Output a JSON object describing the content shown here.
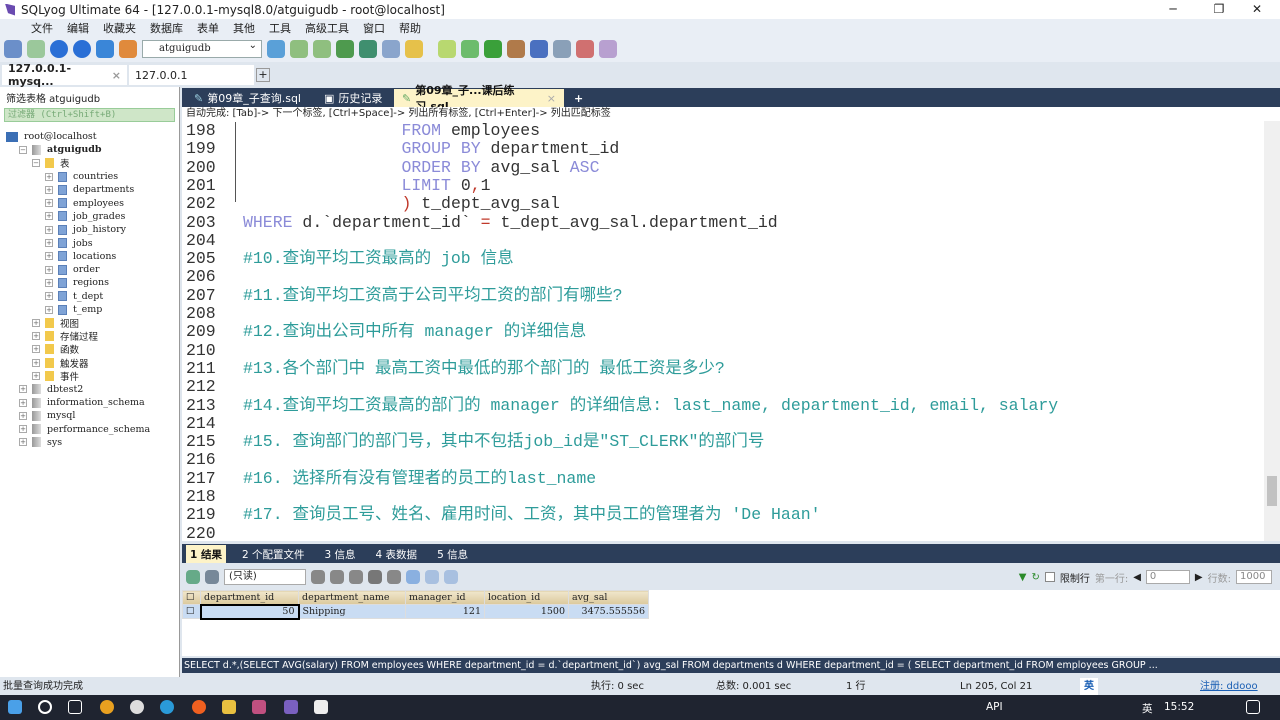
{
  "window": {
    "title": "SQLyog Ultimate 64 - [127.0.0.1-mysql8.0/atguigudb - root@localhost]",
    "minimize": "─",
    "maximize": "❐",
    "close": "✕"
  },
  "menu": [
    "文件",
    "编辑",
    "收藏夹",
    "数据库",
    "表单",
    "其他",
    "工具",
    "高级工具",
    "窗口",
    "帮助"
  ],
  "toolbar": {
    "database": "atguigudb"
  },
  "connection_tabs": [
    {
      "label": "127.0.0.1-mysq...",
      "close": "×"
    },
    {
      "label": "127.0.0.1"
    }
  ],
  "sidebar": {
    "filter_label": "筛选表格 atguigudb",
    "filter_placeholder": "过滤器 (Ctrl+Shift+B)",
    "tree": [
      {
        "label": "root@localhost",
        "level": 0,
        "icon": "server",
        "pm": ""
      },
      {
        "label": "atguigudb",
        "level": 1,
        "icon": "db",
        "pm": "⊟",
        "bold": true
      },
      {
        "label": "表",
        "level": 2,
        "icon": "folder",
        "pm": "⊟"
      },
      {
        "label": "countries",
        "level": 3,
        "icon": "table",
        "pm": "+"
      },
      {
        "label": "departments",
        "level": 3,
        "icon": "table",
        "pm": "+"
      },
      {
        "label": "employees",
        "level": 3,
        "icon": "table",
        "pm": "+"
      },
      {
        "label": "job_grades",
        "level": 3,
        "icon": "table",
        "pm": "+"
      },
      {
        "label": "job_history",
        "level": 3,
        "icon": "table",
        "pm": "+"
      },
      {
        "label": "jobs",
        "level": 3,
        "icon": "table",
        "pm": "+"
      },
      {
        "label": "locations",
        "level": 3,
        "icon": "table",
        "pm": "+"
      },
      {
        "label": "order",
        "level": 3,
        "icon": "table",
        "pm": "+"
      },
      {
        "label": "regions",
        "level": 3,
        "icon": "table",
        "pm": "+"
      },
      {
        "label": "t_dept",
        "level": 3,
        "icon": "table",
        "pm": "+"
      },
      {
        "label": "t_emp",
        "level": 3,
        "icon": "table",
        "pm": "+"
      },
      {
        "label": "视图",
        "level": 2,
        "icon": "folder",
        "pm": "+"
      },
      {
        "label": "存储过程",
        "level": 2,
        "icon": "folder",
        "pm": "+"
      },
      {
        "label": "函数",
        "level": 2,
        "icon": "folder",
        "pm": "+"
      },
      {
        "label": "触发器",
        "level": 2,
        "icon": "folder",
        "pm": "+"
      },
      {
        "label": "事件",
        "level": 2,
        "icon": "folder",
        "pm": "+"
      },
      {
        "label": "dbtest2",
        "level": 1,
        "icon": "db",
        "pm": "+"
      },
      {
        "label": "information_schema",
        "level": 1,
        "icon": "db",
        "pm": "+"
      },
      {
        "label": "mysql",
        "level": 1,
        "icon": "db",
        "pm": "+"
      },
      {
        "label": "performance_schema",
        "level": 1,
        "icon": "db",
        "pm": "+"
      },
      {
        "label": "sys",
        "level": 1,
        "icon": "db",
        "pm": "+"
      }
    ]
  },
  "editor_tabs": [
    {
      "label": "第09章_子查询.sql"
    },
    {
      "label": "历史记录"
    },
    {
      "label": "第09章_子...课后练习.sql",
      "close": "×",
      "active": true
    }
  ],
  "editor_tabs_add": "+",
  "autocomplete_hint": "自动完成: [Tab]-> 下一个标签, [Ctrl+Space]-> 列出所有标签, [Ctrl+Enter]-> 列出匹配标签",
  "editor": {
    "lines": [
      {
        "n": "198",
        "tokens": [
          [
            "p",
            "                "
          ],
          [
            "k",
            "FROM"
          ],
          [
            "p",
            " employees"
          ]
        ]
      },
      {
        "n": "199",
        "tokens": [
          [
            "p",
            "                "
          ],
          [
            "k",
            "GROUP BY"
          ],
          [
            "p",
            " department_id"
          ]
        ]
      },
      {
        "n": "200",
        "tokens": [
          [
            "p",
            "                "
          ],
          [
            "k",
            "ORDER BY"
          ],
          [
            "p",
            " avg_sal "
          ],
          [
            "k",
            "ASC"
          ]
        ]
      },
      {
        "n": "201",
        "tokens": [
          [
            "p",
            "                "
          ],
          [
            "k",
            "LIMIT"
          ],
          [
            "p",
            " 0"
          ],
          [
            "r",
            ","
          ],
          [
            "p",
            "1"
          ]
        ]
      },
      {
        "n": "202",
        "tokens": [
          [
            "p",
            "                "
          ],
          [
            "r",
            ")"
          ],
          [
            "p",
            " t_dept_avg_sal"
          ]
        ]
      },
      {
        "n": "203",
        "tokens": [
          [
            "k",
            "WHERE"
          ],
          [
            "p",
            " d.`department_id` "
          ],
          [
            "r",
            "="
          ],
          [
            "p",
            " t_dept_avg_sal.department_id"
          ]
        ]
      },
      {
        "n": "204",
        "tokens": []
      },
      {
        "n": "205",
        "tokens": [
          [
            "c",
            "#10.查询平均工资最高的 job 信息"
          ]
        ]
      },
      {
        "n": "206",
        "tokens": []
      },
      {
        "n": "207",
        "tokens": [
          [
            "c",
            "#11.查询平均工资高于公司平均工资的部门有哪些?"
          ]
        ]
      },
      {
        "n": "208",
        "tokens": []
      },
      {
        "n": "209",
        "tokens": [
          [
            "c",
            "#12.查询出公司中所有 manager 的详细信息"
          ]
        ]
      },
      {
        "n": "210",
        "tokens": []
      },
      {
        "n": "211",
        "tokens": [
          [
            "c",
            "#13.各个部门中 最高工资中最低的那个部门的 最低工资是多少?"
          ]
        ]
      },
      {
        "n": "212",
        "tokens": []
      },
      {
        "n": "213",
        "tokens": [
          [
            "c",
            "#14.查询平均工资最高的部门的 manager 的详细信息: last_name, department_id, email, salary"
          ]
        ]
      },
      {
        "n": "214",
        "tokens": []
      },
      {
        "n": "215",
        "tokens": [
          [
            "c",
            "#15. 查询部门的部门号，其中不包括job_id是\"ST_CLERK\"的部门号"
          ]
        ]
      },
      {
        "n": "216",
        "tokens": []
      },
      {
        "n": "217",
        "tokens": [
          [
            "c",
            "#16. 选择所有没有管理者的员工的last_name"
          ]
        ]
      },
      {
        "n": "218",
        "tokens": []
      },
      {
        "n": "219",
        "tokens": [
          [
            "c",
            "#17. 查询员工号、姓名、雇用时间、工资，其中员工的管理者为 'De Haan'"
          ]
        ]
      },
      {
        "n": "220",
        "tokens": []
      }
    ]
  },
  "result_tabs": [
    "1 结果",
    "2 个配置文件",
    "3 信息",
    "4 表数据",
    "5 信息"
  ],
  "result_toolbar": {
    "mode": "(只读)",
    "limit_label": "限制行",
    "first_row_label": "第一行:",
    "first_row": "0",
    "rows_label": "行数:",
    "rows": "1000"
  },
  "result_grid": {
    "columns": [
      "department_id",
      "department_name",
      "manager_id",
      "location_id",
      "avg_sal"
    ],
    "rows": [
      [
        "50",
        "Shipping",
        "121",
        "1500",
        "3475.555556"
      ]
    ]
  },
  "sql_status": "SELECT d.*,(SELECT AVG(salary) FROM employees WHERE department_id = d.`department_id`) avg_sal FROM departments d WHERE department_id = ( SELECT department_id FROM employees GROUP ...",
  "statusbar": {
    "message": "批量查询成功完成",
    "exec": "执行: 0 sec",
    "total": "总数: 0.001 sec",
    "rows": "1 行",
    "position": "Ln 205, Col 21",
    "ime": "英",
    "register": "注册: ddooo"
  },
  "taskbar": {
    "api": "API",
    "lang": "英",
    "time": "15:52"
  },
  "colors": {
    "keyword": "#8b8bd8",
    "comment": "#2e9c9a",
    "tab_bar": "#2c3e5a",
    "active_tab": "#fdf3c8"
  }
}
